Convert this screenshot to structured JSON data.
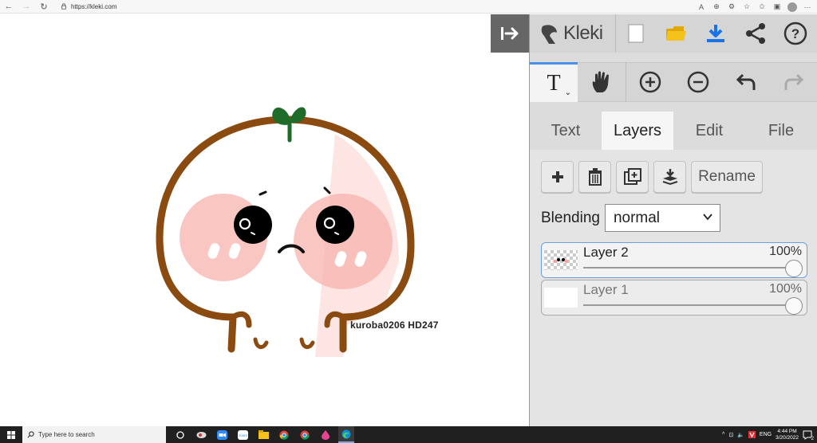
{
  "browser": {
    "url": "https://kleki.com"
  },
  "canvas": {
    "signature": "kuroba0206   HD247"
  },
  "app": {
    "logo_text": "Kleki",
    "tabs": [
      {
        "label": "Text"
      },
      {
        "label": "Layers"
      },
      {
        "label": "Edit"
      },
      {
        "label": "File"
      }
    ],
    "text_tool_glyph": "T",
    "layers": {
      "rename_label": "Rename",
      "blending_label": "Blending",
      "blend_mode": "normal",
      "items": [
        {
          "name": "Layer 2",
          "opacity": "100%",
          "selected": true
        },
        {
          "name": "Layer 1",
          "opacity": "100%",
          "selected": false
        }
      ]
    }
  },
  "taskbar": {
    "search_placeholder": "Type here to search",
    "time": "4:44 PM",
    "date": "3/20/2022",
    "lang": "ENG",
    "notifications": "2"
  },
  "colors": {
    "accent": "#4a8fe7",
    "download_blue": "#1a73e8",
    "folder_yellow": "#f3c31c",
    "brown_outline": "#8a4a10",
    "sprout_green": "#1f6b2a",
    "blush": "#f4a6a0"
  }
}
